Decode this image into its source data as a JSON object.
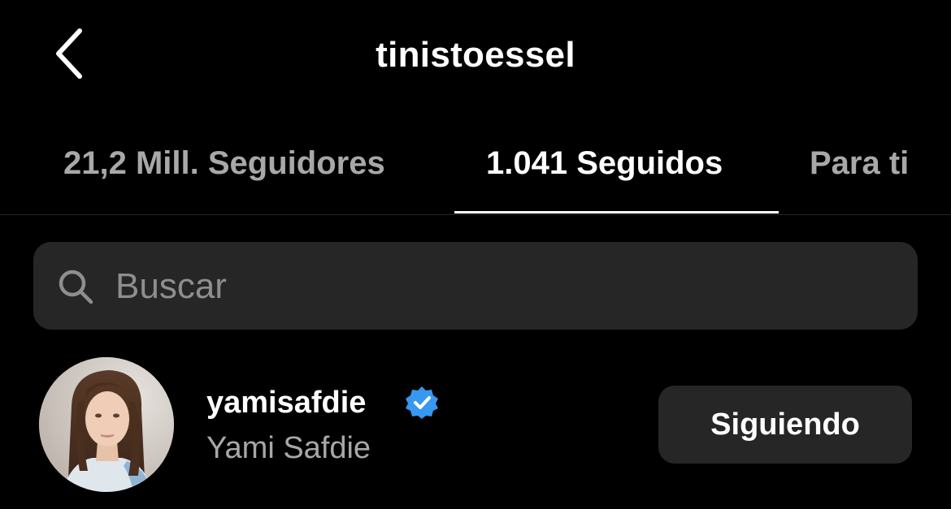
{
  "header": {
    "title": "tinistoessel",
    "back_icon": "chevron-left-icon"
  },
  "tabs": [
    {
      "label": "21,2 Mill. Seguidores",
      "active": false
    },
    {
      "label": "1.041 Seguidos",
      "active": true
    },
    {
      "label": "Para ti",
      "active": false
    }
  ],
  "search": {
    "placeholder": "Buscar",
    "icon": "search-icon"
  },
  "users": [
    {
      "username": "yamisafdie",
      "full_name": "Yami Safdie",
      "verified": true,
      "verified_color": "#3897f0",
      "button_label": "Siguiendo"
    }
  ],
  "colors": {
    "background": "#000000",
    "surface": "#262626",
    "text_primary": "#ffffff",
    "text_secondary": "#a8a8a8",
    "placeholder": "#8e8e8e",
    "verified": "#3897f0"
  }
}
